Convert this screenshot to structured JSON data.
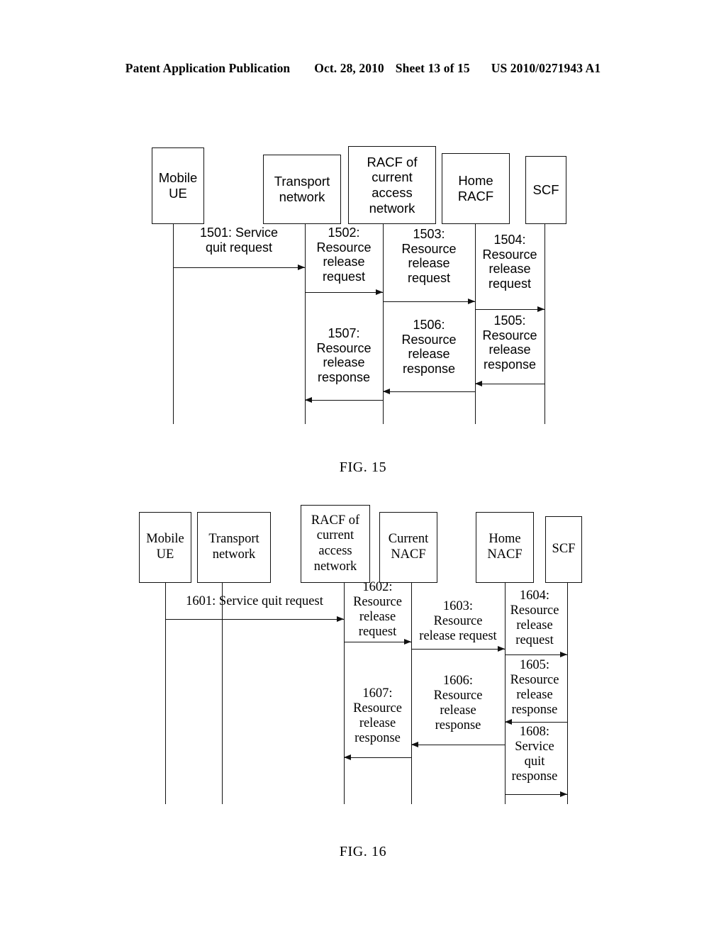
{
  "header": {
    "publication": "Patent Application Publication",
    "date": "Oct. 28, 2010",
    "sheet": "Sheet 13 of 15",
    "patent_number": "US 2010/0271943 A1"
  },
  "figures": [
    {
      "caption": "FIG. 15",
      "nodes": [
        {
          "label": "Mobile\nUE"
        },
        {
          "label": "Transport\nnetwork"
        },
        {
          "label": "RACF of\ncurrent\naccess\nnetwork"
        },
        {
          "label": "Home\nRACF"
        },
        {
          "label": "SCF"
        }
      ],
      "messages": [
        {
          "label": "1501: Service\nquit request",
          "from": "Mobile UE",
          "to": "Transport network",
          "direction": "right"
        },
        {
          "label": "1502:\nResource\nrelease\nrequest",
          "from": "Transport network",
          "to": "RACF of current access network",
          "direction": "right"
        },
        {
          "label": "1503:\nResource\nrelease\nrequest",
          "from": "RACF of current access network",
          "to": "Home RACF",
          "direction": "right"
        },
        {
          "label": "1504:\nResource\nrelease\nrequest",
          "from": "Home RACF",
          "to": "SCF",
          "direction": "right"
        },
        {
          "label": "1505:\nResource\nrelease\nresponse",
          "from": "SCF",
          "to": "Home RACF",
          "direction": "left"
        },
        {
          "label": "1506:\nResource\nrelease\nresponse",
          "from": "Home RACF",
          "to": "RACF of current access network",
          "direction": "left"
        },
        {
          "label": "1507:\nResource\nrelease\nresponse",
          "from": "RACF of current access network",
          "to": "Transport network",
          "direction": "left"
        }
      ]
    },
    {
      "caption": "FIG. 16",
      "nodes": [
        {
          "label": "Mobile\nUE"
        },
        {
          "label": "Transport\nnetwork"
        },
        {
          "label": "RACF of\ncurrent\naccess\nnetwork"
        },
        {
          "label": "Current\nNACF"
        },
        {
          "label": "Home\nNACF"
        },
        {
          "label": "SCF"
        }
      ],
      "messages": [
        {
          "label": "1601: Service quit request",
          "from": "Mobile UE",
          "to": "RACF of current access network",
          "direction": "right"
        },
        {
          "label": "1602:\nResource\nrelease\nrequest",
          "from": "RACF of current access network",
          "to": "Current NACF",
          "direction": "right"
        },
        {
          "label": "1603:\nResource\nrelease request",
          "from": "Current NACF",
          "to": "Home NACF",
          "direction": "right"
        },
        {
          "label": "1604:\nResource\nrelease\nrequest",
          "from": "Home NACF",
          "to": "SCF",
          "direction": "right"
        },
        {
          "label": "1605:\nResource\nrelease\nresponse",
          "from": "SCF",
          "to": "Home NACF",
          "direction": "left"
        },
        {
          "label": "1606:\nResource\nrelease\nresponse",
          "from": "Home NACF",
          "to": "Current NACF",
          "direction": "left"
        },
        {
          "label": "1607:\nResource\nrelease\nresponse",
          "from": "Current NACF",
          "to": "RACF of current access network",
          "direction": "left"
        },
        {
          "label": "1608:\nService\nquit\nresponse",
          "from": "Home NACF",
          "to": "SCF",
          "direction": "right"
        }
      ]
    }
  ]
}
